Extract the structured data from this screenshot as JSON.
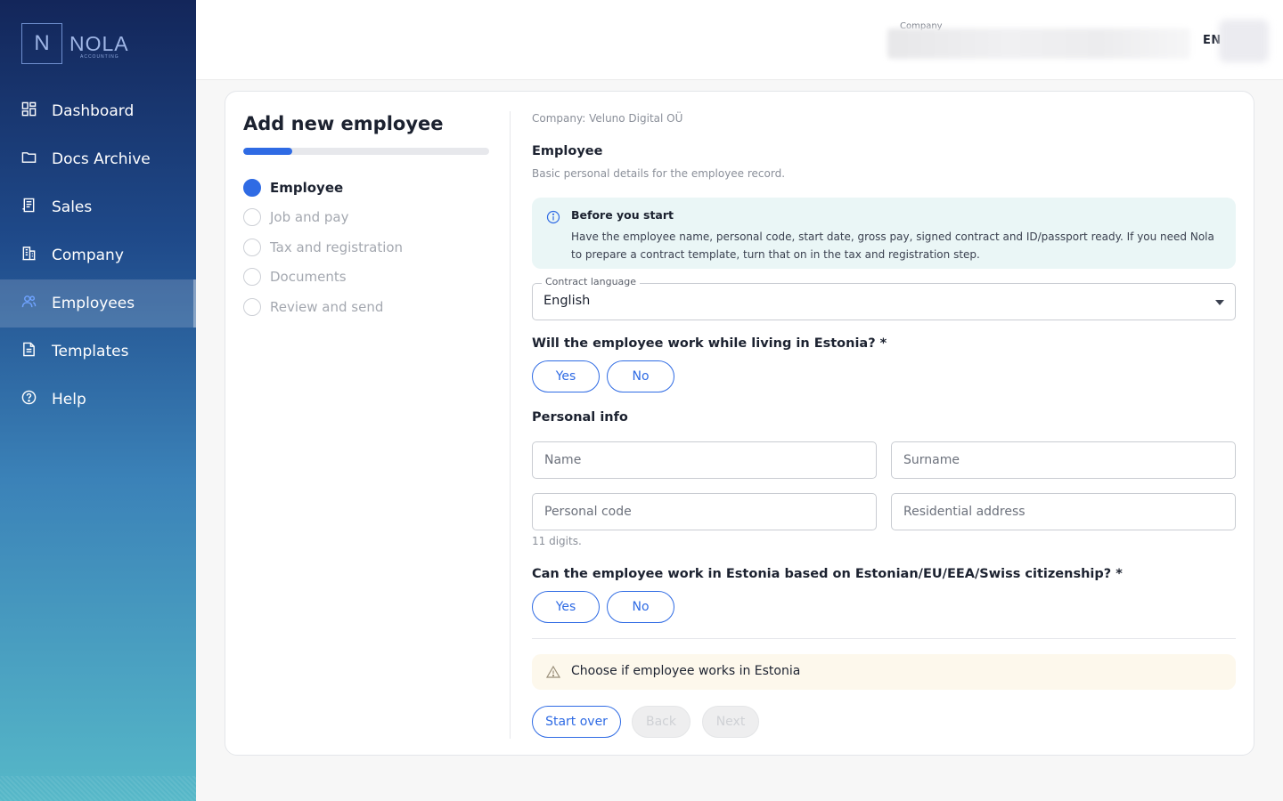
{
  "brand": {
    "logo_letter": "N",
    "name": "NOLA",
    "tagline": "ACCOUNTING"
  },
  "sidebar": {
    "items": [
      {
        "label": "Dashboard",
        "icon": "dashboard-icon"
      },
      {
        "label": "Docs Archive",
        "icon": "folder-icon"
      },
      {
        "label": "Sales",
        "icon": "receipt-icon"
      },
      {
        "label": "Company",
        "icon": "building-icon"
      },
      {
        "label": "Employees",
        "icon": "users-icon",
        "active": true
      },
      {
        "label": "Templates",
        "icon": "document-icon"
      },
      {
        "label": "Help",
        "icon": "help-circle-icon"
      }
    ]
  },
  "header": {
    "company_label": "Company",
    "language": "EN"
  },
  "wizard": {
    "title": "Add new employee",
    "progress": 0.2,
    "steps": [
      {
        "label": "Employee",
        "active": true
      },
      {
        "label": "Job and pay",
        "active": false
      },
      {
        "label": "Tax and registration",
        "active": false
      },
      {
        "label": "Documents",
        "active": false
      },
      {
        "label": "Review and send",
        "active": false
      }
    ]
  },
  "form": {
    "company_line": "Company: Veluno Digital OÜ",
    "section_title": "Employee",
    "section_subtitle": "Basic personal details for the employee record.",
    "info": {
      "title": "Before you start",
      "text": "Have the employee name, personal code, start date, gross pay, signed contract and ID/passport ready. If you need Nola to prepare a contract template, turn that on in the tax and registration step."
    },
    "contract_language": {
      "label": "Contract language",
      "value": "English"
    },
    "q_living": {
      "label": "Will the employee work while living in Estonia? *",
      "yes": "Yes",
      "no": "No"
    },
    "personal_info": {
      "title": "Personal info",
      "name_placeholder": "Name",
      "surname_placeholder": "Surname",
      "personal_code_placeholder": "Personal code",
      "address_placeholder": "Residential address",
      "personal_code_hint": "11 digits."
    },
    "q_citizenship": {
      "label": "Can the employee work in Estonia based on Estonian/EU/EEA/Swiss citizenship? *",
      "yes": "Yes",
      "no": "No"
    },
    "warning": "Choose if employee works in Estonia",
    "buttons": {
      "start_over": "Start over",
      "back": "Back",
      "next": "Next"
    }
  },
  "colors": {
    "accent": "#2f6be4",
    "info_bg": "#eaf6f6",
    "warning_bg": "#fdf8ec"
  }
}
